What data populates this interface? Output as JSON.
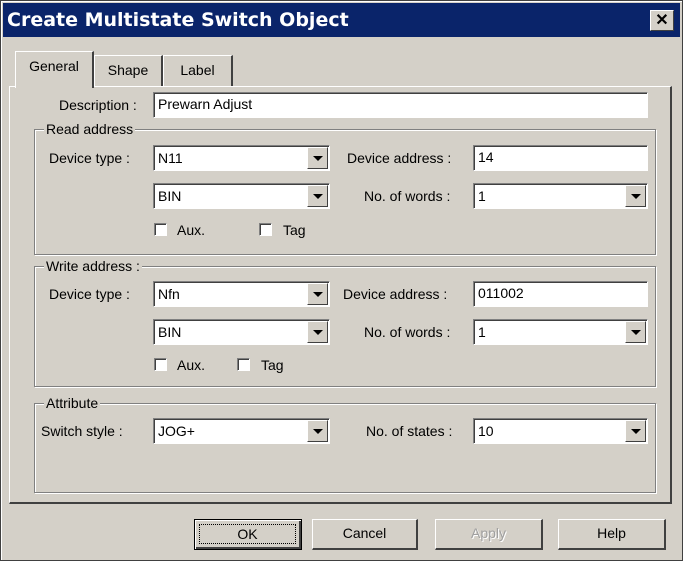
{
  "window": {
    "title": "Create Multistate Switch  Object"
  },
  "tabs": [
    {
      "label": "General"
    },
    {
      "label": "Shape"
    },
    {
      "label": "Label"
    }
  ],
  "general": {
    "description_label": "Description :",
    "description_value": "Prewarn Adjust"
  },
  "read_address": {
    "legend": "Read address",
    "device_type_label": "Device type :",
    "device_type_value": "N11",
    "device_address_label": "Device address :",
    "device_address_value": "14",
    "format_value": "BIN",
    "words_label": "No. of words :",
    "words_value": "1",
    "aux_label": "Aux.",
    "aux_checked": false,
    "tag_label": "Tag",
    "tag_checked": false
  },
  "write_address": {
    "legend": "Write address :",
    "device_type_label": "Device type :",
    "device_type_value": "Nfn",
    "device_address_label": "Device  address :",
    "device_address_value": "011002",
    "format_value": "BIN",
    "words_label": "No. of words :",
    "words_value": "1",
    "aux_label": "Aux.",
    "aux_checked": false,
    "tag_label": "Tag",
    "tag_checked": false
  },
  "attribute": {
    "legend": "Attribute",
    "switch_style_label": "Switch style :",
    "switch_style_value": "JOG+",
    "states_label": "No. of states :",
    "states_value": "10"
  },
  "buttons": {
    "ok": "OK",
    "cancel": "Cancel",
    "apply": "Apply",
    "help": "Help"
  },
  "icons": {
    "close": "close-icon",
    "dropdown": "chevron-down-icon"
  }
}
